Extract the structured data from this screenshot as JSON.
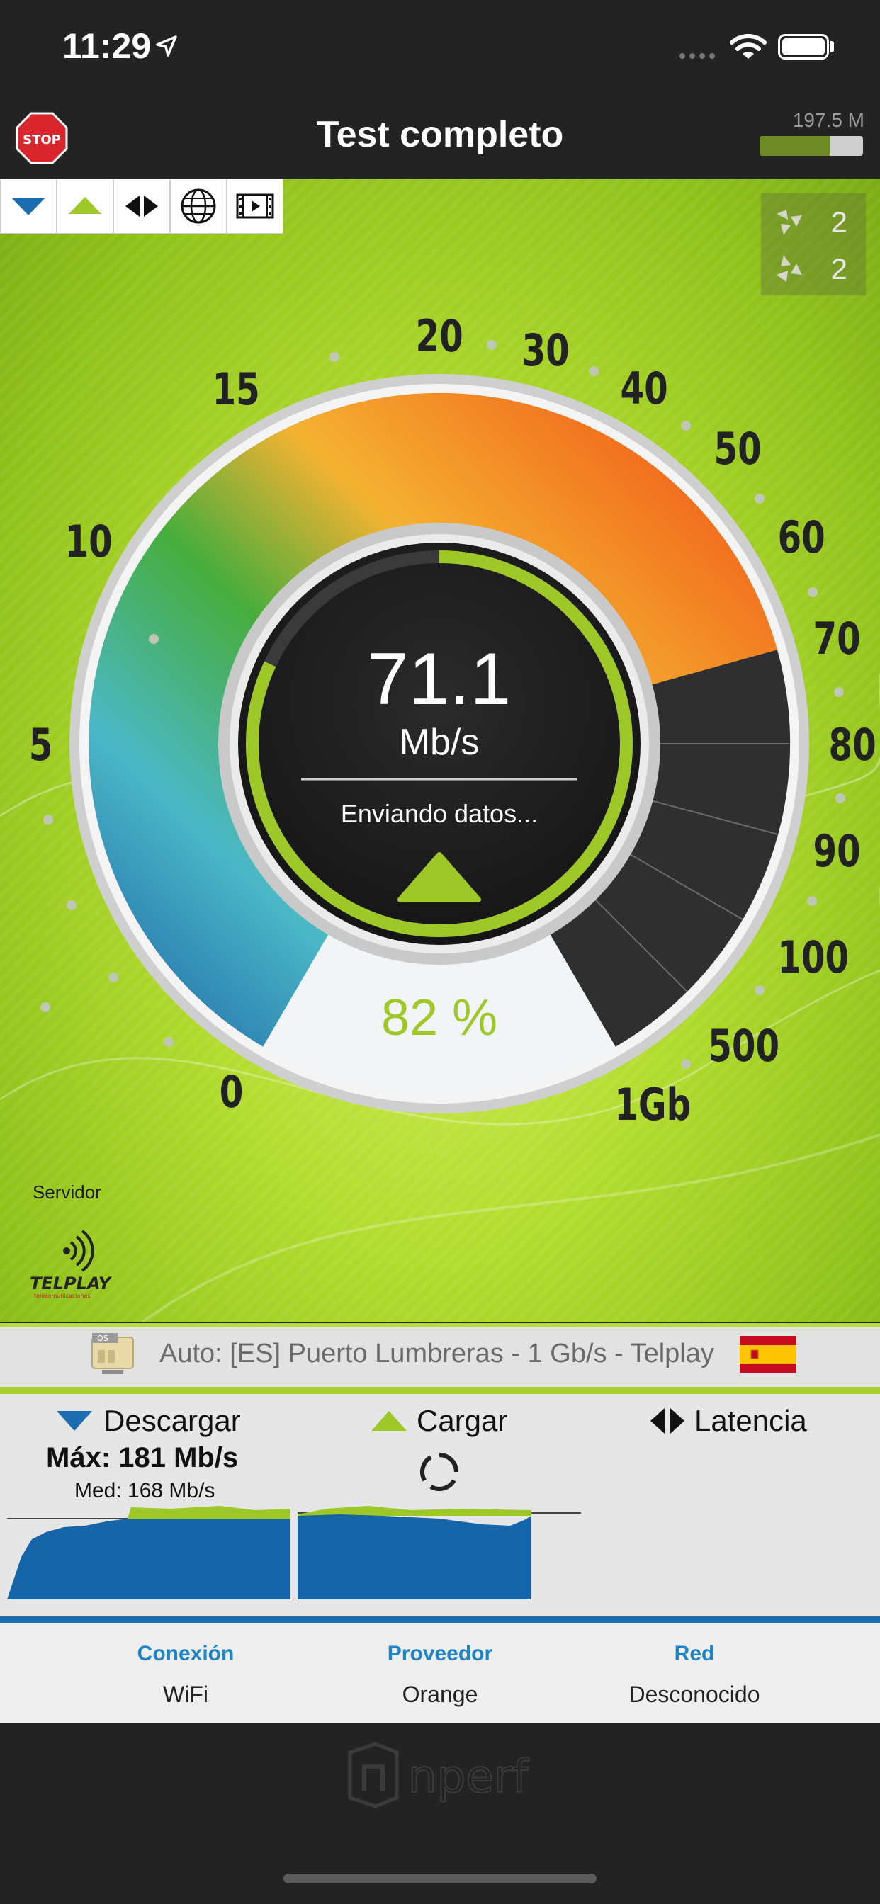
{
  "status_bar": {
    "time": "11:29",
    "icons": [
      "location-arrow-icon",
      "signal-icon",
      "wifi-icon",
      "battery-icon"
    ]
  },
  "header": {
    "stop_label": "STOP",
    "title": "Test completo",
    "data_used": "197.5 M",
    "data_used_fraction": 0.68
  },
  "tabs": [
    "download-icon",
    "upload-icon",
    "latency-icon",
    "globe-icon",
    "video-icon"
  ],
  "peers": {
    "down_count": "2",
    "up_count": "2"
  },
  "gauge": {
    "scale_labels": [
      "0",
      "5",
      "10",
      "15",
      "20",
      "30",
      "40",
      "50",
      "60",
      "70",
      "80",
      "90",
      "100",
      "500",
      "1Gb"
    ],
    "speed": "71.1",
    "unit": "Mb/s",
    "status": "Enviando datos...",
    "progress_percent": "82 %",
    "progress_fraction": 0.82
  },
  "server": {
    "label": "Servidor",
    "logo_text": "TELPLAY",
    "logo_subtext": "telecomunicaciones",
    "icon_badge": "iOS",
    "description": "Auto: [ES] Puerto Lumbreras - 1 Gb/s - Telplay",
    "flag_icon": "spain-flag-icon"
  },
  "results": {
    "download_label": "Descargar",
    "upload_label": "Cargar",
    "latency_label": "Latencia",
    "download_max": "Máx: 181 Mb/s",
    "download_avg": "Med: 168 Mb/s"
  },
  "info": {
    "connection_label": "Conexión",
    "connection_value": "WiFi",
    "provider_label": "Proveedor",
    "provider_value": "Orange",
    "network_label": "Red",
    "network_value": "Desconocido"
  },
  "footer": {
    "logo": "nperf"
  },
  "colors": {
    "accent_green": "#9dc828",
    "download_blue": "#1565a8",
    "link_blue": "#1e84c6",
    "dark_bg": "#232323"
  }
}
